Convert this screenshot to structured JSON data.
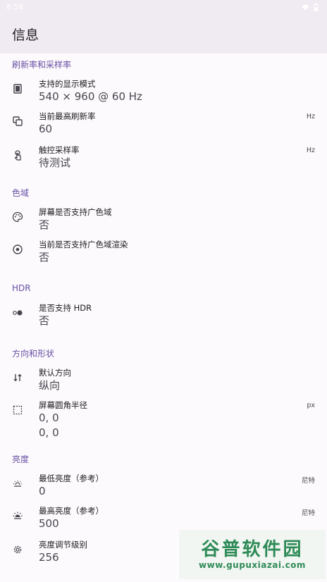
{
  "status": {
    "time": "8:56"
  },
  "app": {
    "title": "信息"
  },
  "sections": {
    "refresh": {
      "header": "刷新率和采样率",
      "display_modes": {
        "label": "支持的显示模式",
        "value": "540 × 960 @ 60 Hz"
      },
      "max_refresh": {
        "label": "当前最高刷新率",
        "value": "60",
        "unit": "Hz"
      },
      "touch_sampling": {
        "label": "触控采样率",
        "value": "待测试",
        "unit": "Hz"
      }
    },
    "gamut": {
      "header": "色域",
      "wide_gamut_screen": {
        "label": "屏幕是否支持广色域",
        "value": "否"
      },
      "wide_gamut_render": {
        "label": "当前是否支持广色域渲染",
        "value": "否"
      }
    },
    "hdr": {
      "header": "HDR",
      "supports_hdr": {
        "label": "是否支持 HDR",
        "value": "否"
      }
    },
    "orientation": {
      "header": "方向和形状",
      "default_orientation": {
        "label": "默认方向",
        "value": "纵向"
      },
      "corner_radius": {
        "label": "屏幕圆角半径",
        "value1": "0, 0",
        "value2": "0, 0",
        "unit": "px"
      }
    },
    "brightness": {
      "header": "亮度",
      "min_brightness": {
        "label": "最低亮度（参考）",
        "value": "0",
        "unit": "尼特"
      },
      "max_brightness": {
        "label": "最高亮度（参考）",
        "value": "500",
        "unit": "尼特"
      },
      "levels": {
        "label": "亮度调节级别",
        "value": "256"
      }
    }
  },
  "watermark": {
    "title": "谷普软件园",
    "url": "www.gupuxiazai.com"
  },
  "colors": {
    "accent": "#6750a4",
    "appbar": "#f0ebf2",
    "background": "#fdfafd"
  }
}
